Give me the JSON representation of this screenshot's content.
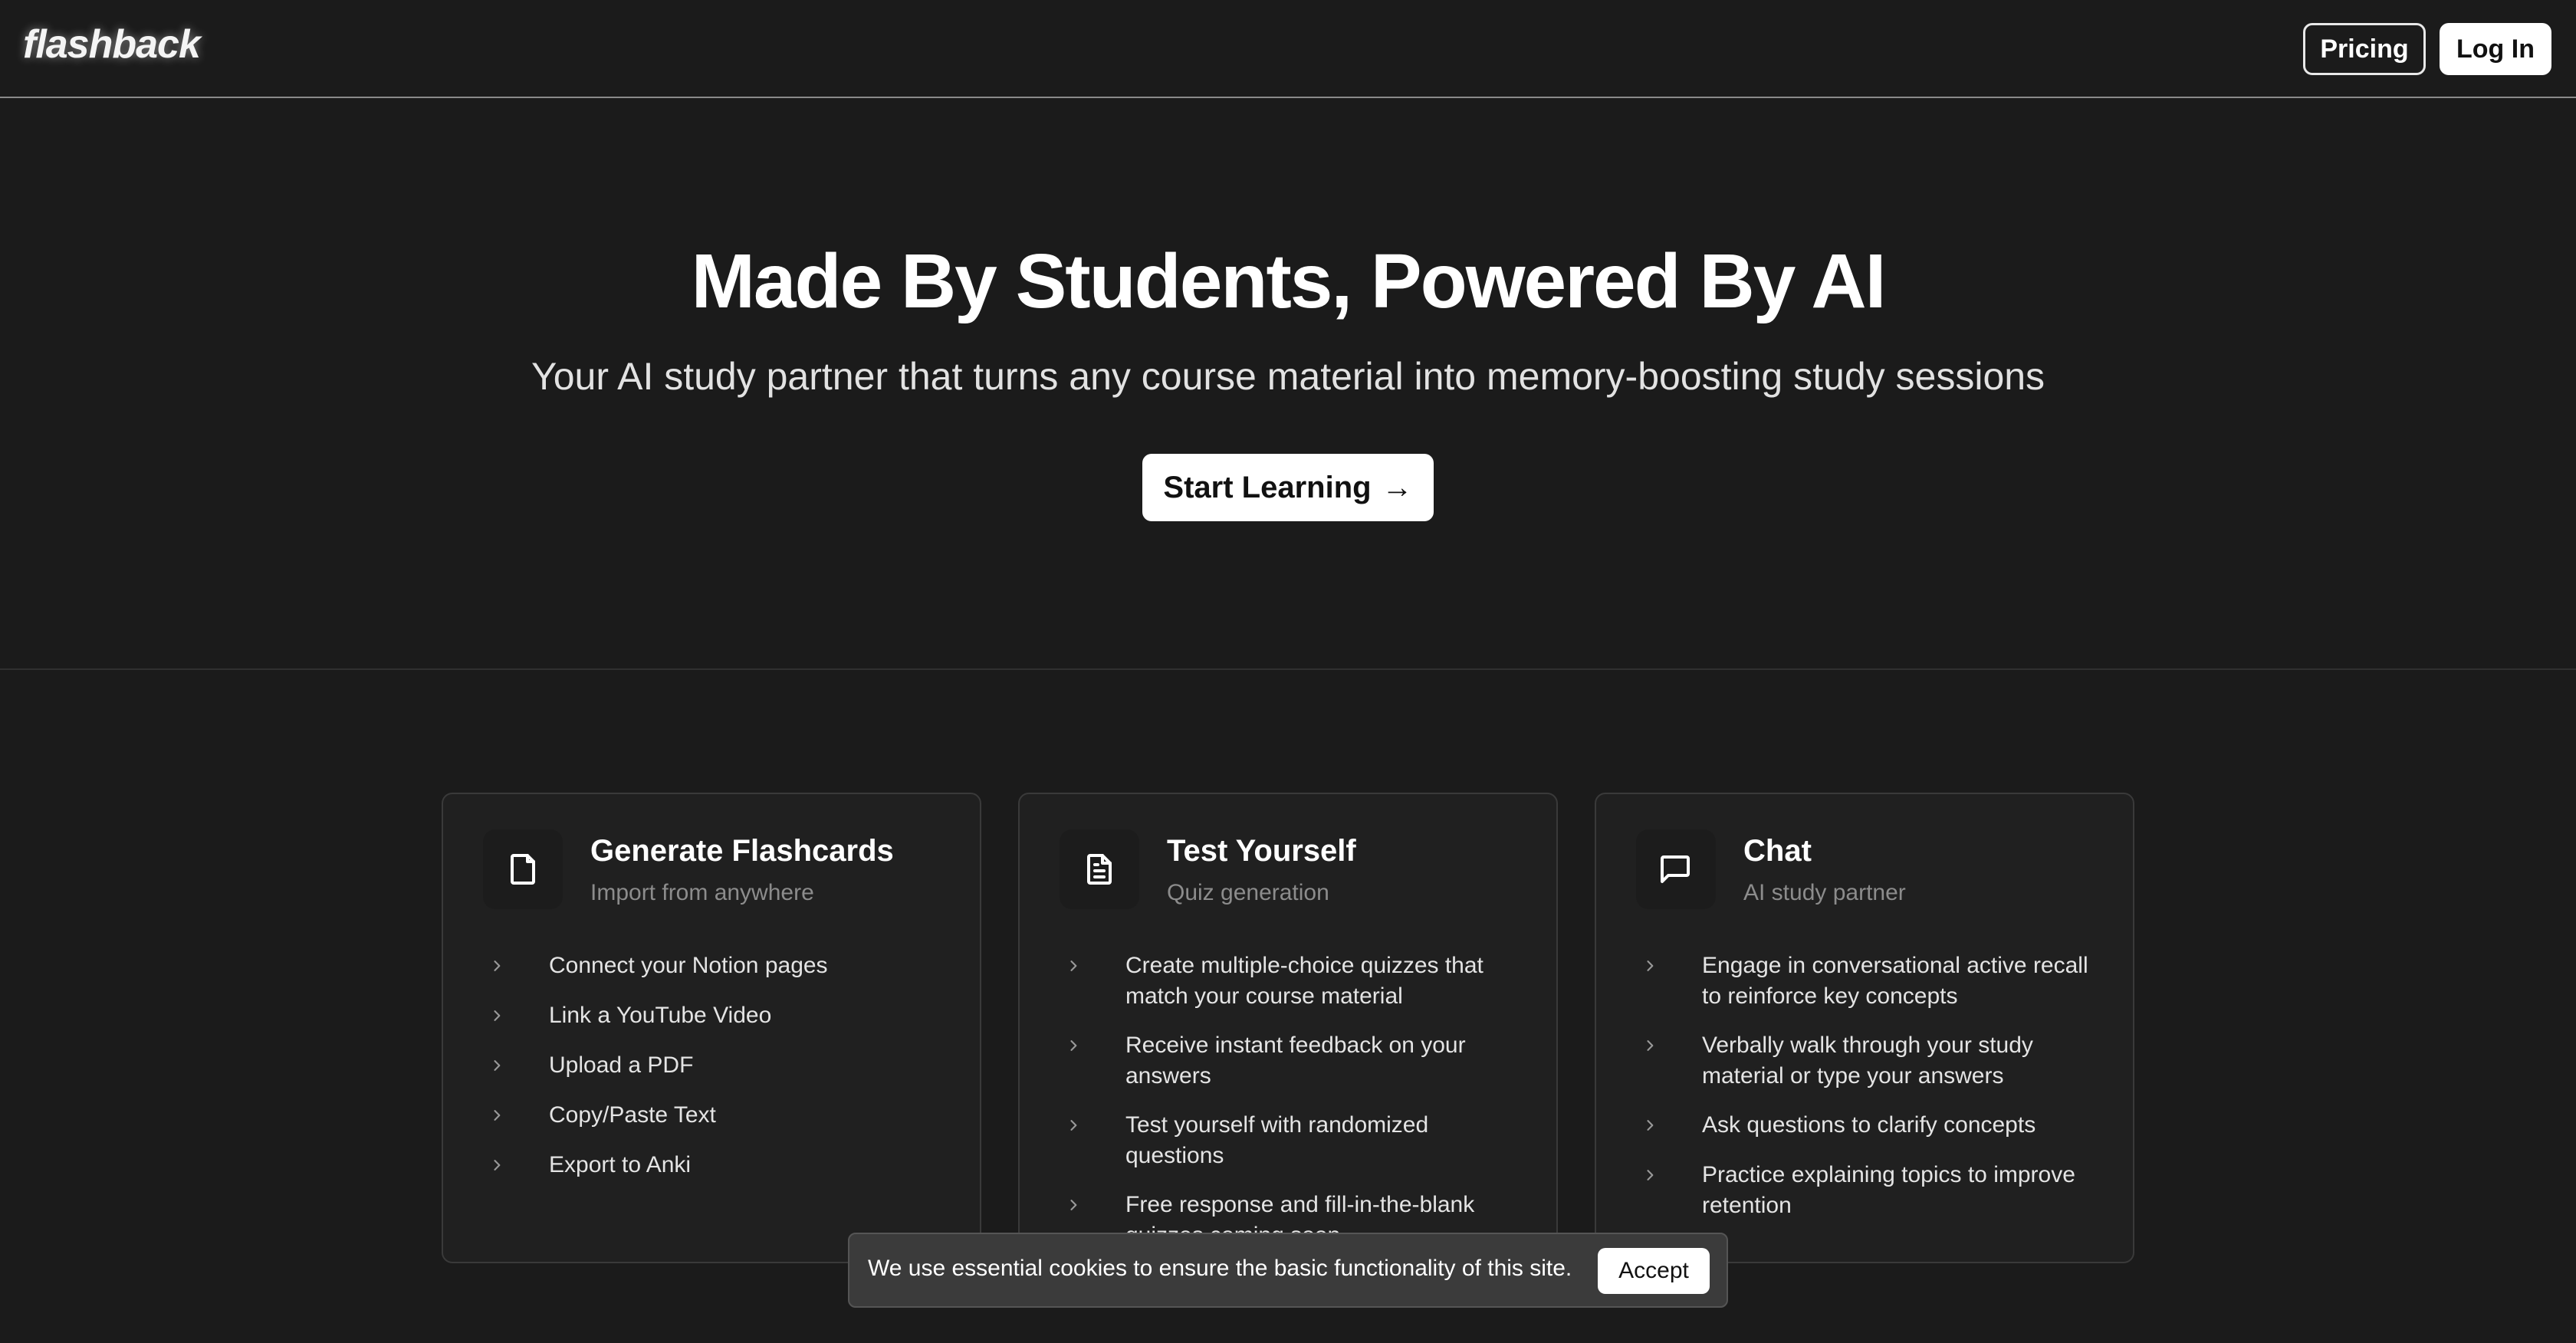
{
  "header": {
    "logo": "flashback",
    "pricing_label": "Pricing",
    "login_label": "Log In"
  },
  "hero": {
    "title": "Made By Students, Powered By AI",
    "subtitle": "Your AI study partner that turns any course material into memory-boosting study sessions",
    "cta_label": "Start Learning",
    "cta_icon": "arrow-right-icon"
  },
  "features": [
    {
      "icon": "file-icon",
      "title": "Generate Flashcards",
      "subtitle": "Import from anywhere",
      "items": [
        "Connect your Notion pages",
        "Link a YouTube Video",
        "Upload a PDF",
        "Copy/Paste Text",
        "Export to Anki"
      ]
    },
    {
      "icon": "file-text-icon",
      "title": "Test Yourself",
      "subtitle": "Quiz generation",
      "items": [
        "Create multiple-choice quizzes that match your course material",
        "Receive instant feedback on your answers",
        "Test yourself with randomized questions",
        "Free response and fill-in-the-blank quizzes coming soon"
      ]
    },
    {
      "icon": "message-square-icon",
      "title": "Chat",
      "subtitle": "AI study partner",
      "items": [
        "Engage in conversational active recall to reinforce key concepts",
        "Verbally walk through your study material or type your answers",
        "Ask questions to clarify concepts",
        "Practice explaining topics to improve retention"
      ]
    }
  ],
  "cookie_banner": {
    "text": "We use essential cookies to ensure the basic functionality of this site.",
    "accept_label": "Accept"
  },
  "colors": {
    "background": "#1b1b1b",
    "card_background": "#202020",
    "card_border": "#3a3a3a",
    "button_background": "#ffffff",
    "muted_text": "#8c8c8c"
  }
}
